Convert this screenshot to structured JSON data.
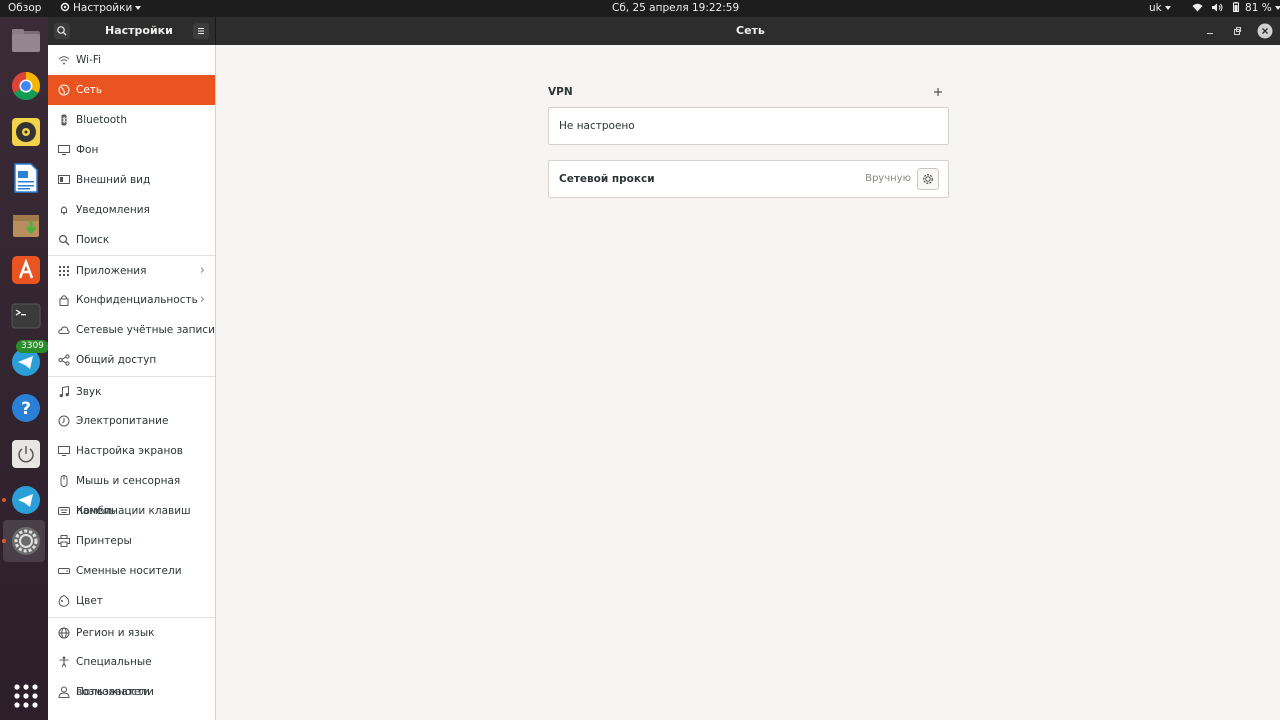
{
  "topbar": {
    "activities": "Обзор",
    "app_menu": "Настройки",
    "clock": "Сб, 25 апреля  19:22:59",
    "keyboard_layout": "uk",
    "battery": "81 %"
  },
  "dock": {
    "telegram_badge": "3309"
  },
  "header": {
    "sidebar_title": "Настройки",
    "panel_title": "Сеть"
  },
  "sidebar": {
    "items": [
      {
        "label": "Wi-Fi"
      },
      {
        "label": "Сеть"
      },
      {
        "label": "Bluetooth"
      },
      {
        "label": "Фон"
      },
      {
        "label": "Внешний вид"
      },
      {
        "label": "Уведомления"
      },
      {
        "label": "Поиск"
      },
      {
        "label": "Приложения"
      },
      {
        "label": "Конфиденциальность"
      },
      {
        "label": "Сетевые учётные записи"
      },
      {
        "label": "Общий доступ"
      },
      {
        "label": "Звук"
      },
      {
        "label": "Электропитание"
      },
      {
        "label": "Настройка экранов"
      },
      {
        "label": "Мышь и сенсорная панель"
      },
      {
        "label": "Комбинации клавиш"
      },
      {
        "label": "Принтеры"
      },
      {
        "label": "Сменные носители"
      },
      {
        "label": "Цвет"
      },
      {
        "label": "Регион и язык"
      },
      {
        "label": "Специальные возможности"
      },
      {
        "label": "Пользователи"
      }
    ]
  },
  "network": {
    "vpn_title": "VPN",
    "vpn_status": "Не настроено",
    "proxy_label": "Сетевой прокси",
    "proxy_value": "Вручную"
  },
  "colors": {
    "accent": "#e95420",
    "headerbar": "#2d2d2d",
    "topbar": "#1d1d1d"
  }
}
